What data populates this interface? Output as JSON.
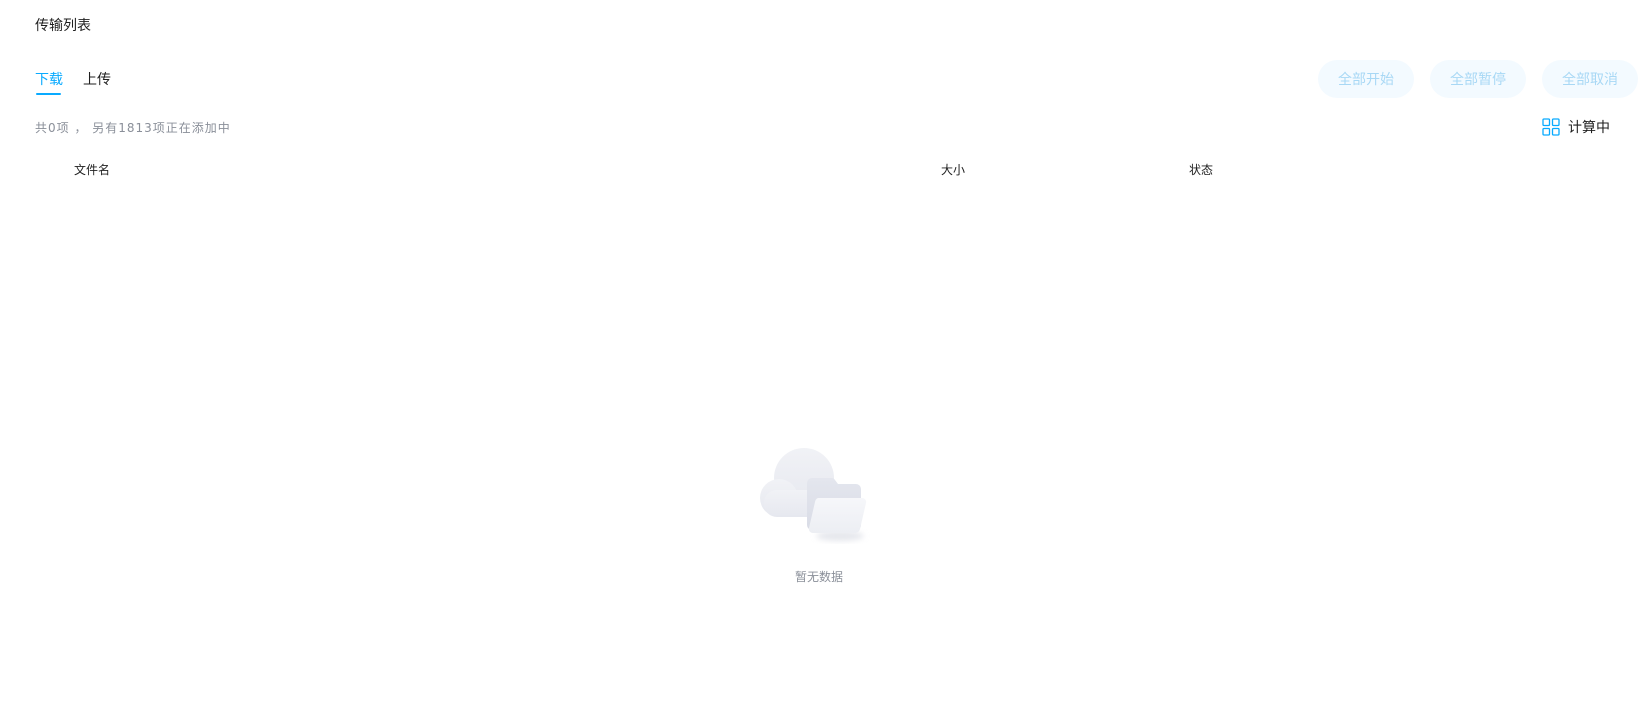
{
  "page": {
    "title": "传输列表"
  },
  "tabs": [
    {
      "label": "下载",
      "active": true
    },
    {
      "label": "上传",
      "active": false
    }
  ],
  "actions": {
    "start_all": "全部开始",
    "pause_all": "全部暂停",
    "cancel_all": "全部取消"
  },
  "summary": {
    "text": "共0项 ， 另有1813项正在添加中"
  },
  "calc": {
    "label": "计算中",
    "icon": "grid-icon"
  },
  "table": {
    "columns": {
      "name": "文件名",
      "size": "大小",
      "status": "状态"
    }
  },
  "empty": {
    "text": "暂无数据",
    "icon": "cloud-folder-icon"
  },
  "colors": {
    "accent": "#09aaff",
    "button_bg": "#f3faff",
    "button_text": "#a8d8f5",
    "muted_text": "#8a8f99"
  }
}
